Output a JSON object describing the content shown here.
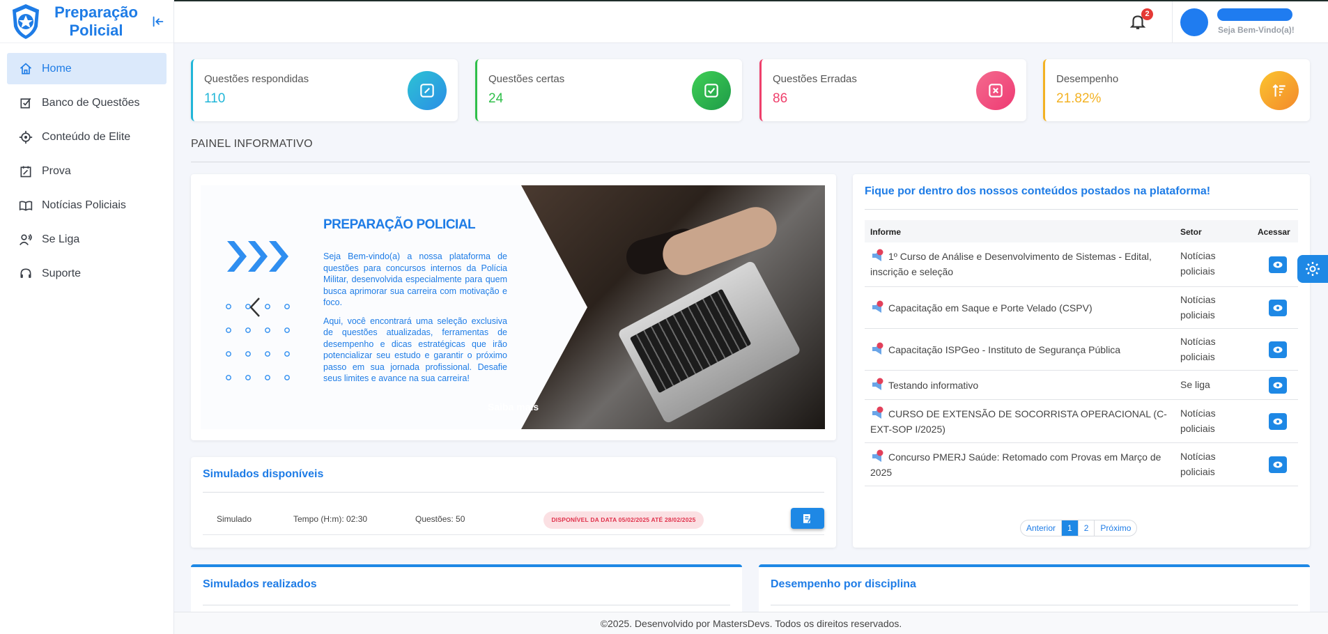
{
  "brand": {
    "title": "Preparação Policial"
  },
  "sidebar": {
    "items": [
      {
        "label": "Home",
        "icon": "home-icon"
      },
      {
        "label": "Banco de Questões",
        "icon": "checklist-icon"
      },
      {
        "label": "Conteúdo de Elite",
        "icon": "target-icon"
      },
      {
        "label": "Prova",
        "icon": "calendar-edit-icon"
      },
      {
        "label": "Notícias Policiais",
        "icon": "book-icon"
      },
      {
        "label": "Se Liga",
        "icon": "user-voice-icon"
      },
      {
        "label": "Suporte",
        "icon": "headset-icon"
      }
    ]
  },
  "header": {
    "notification_count": "2",
    "welcome": "Seja Bem-Vindo(a)!"
  },
  "stats": [
    {
      "label": "Questões respondidas",
      "value": "110",
      "color": "#21b6d8",
      "icon": "edit-icon"
    },
    {
      "label": "Questões certas",
      "value": "24",
      "color": "#2fbf4a",
      "icon": "check-square-icon"
    },
    {
      "label": "Questões Erradas",
      "value": "86",
      "color": "#ef3f6b",
      "icon": "close-square-icon"
    },
    {
      "label": "Desempenho",
      "value": "21.82%",
      "color": "#f3b223",
      "icon": "sort-up-icon"
    }
  ],
  "panel": {
    "title": "PAINEL INFORMATIVO"
  },
  "carousel": {
    "brand": "PREPARAÇÃO POLICIAL",
    "p1": "Seja Bem-vindo(a) a nossa plataforma de questões para concursos internos da Polícia Militar, desenvolvida especialmente para quem busca aprimorar sua carreira com motivação e foco.",
    "p2": "Aqui, você encontrará uma seleção exclusiva de questões atualizadas, ferramentas de desempenho e dicas estratégicas que irão potencializar seu estudo e garantir o próximo passo em sua jornada profissional. Desafie seus limites e avance na sua carreira!",
    "more": "Saiba mais"
  },
  "simulados": {
    "title": "Simulados disponíveis",
    "row": {
      "name": "Simulado",
      "tempo": "Tempo (H:m): 02:30",
      "questoes": "Questões: 50",
      "badge": "DISPONÍVEL DA DATA 05/02/2025 ATÉ 28/02/2025"
    }
  },
  "info": {
    "title": "Fique por dentro dos nossos conteúdos postados na plataforma!",
    "headers": {
      "informe": "Informe",
      "setor": "Setor",
      "acessar": "Acessar"
    },
    "rows": [
      {
        "informe": "1º Curso de Análise e Desenvolvimento de Sistemas - Edital, inscrição e seleção",
        "setor": "Notícias policiais"
      },
      {
        "informe": "Capacitação em Saque e Porte Velado (CSPV)",
        "setor": "Notícias policiais"
      },
      {
        "informe": "Capacitação ISPGeo - Instituto de Segurança Pública",
        "setor": "Notícias policiais"
      },
      {
        "informe": "Testando informativo",
        "setor": "Se liga"
      },
      {
        "informe": "CURSO DE EXTENSÃO DE SOCORRISTA OPERACIONAL (C-EXT-SOP I/2025)",
        "setor": "Notícias policiais"
      },
      {
        "informe": "Concurso PMERJ Saúde: Retomado com Provas em Março de 2025",
        "setor": "Notícias policiais"
      }
    ],
    "pager": {
      "prev": "Anterior",
      "p1": "1",
      "p2": "2",
      "next": "Próximo"
    }
  },
  "lower": {
    "left_title": "Simulados realizados",
    "right_title": "Desempenho por disciplina"
  },
  "footer": {
    "text": "©2025. Desenvolvido por MastersDevs. Todos os direitos reservados."
  }
}
